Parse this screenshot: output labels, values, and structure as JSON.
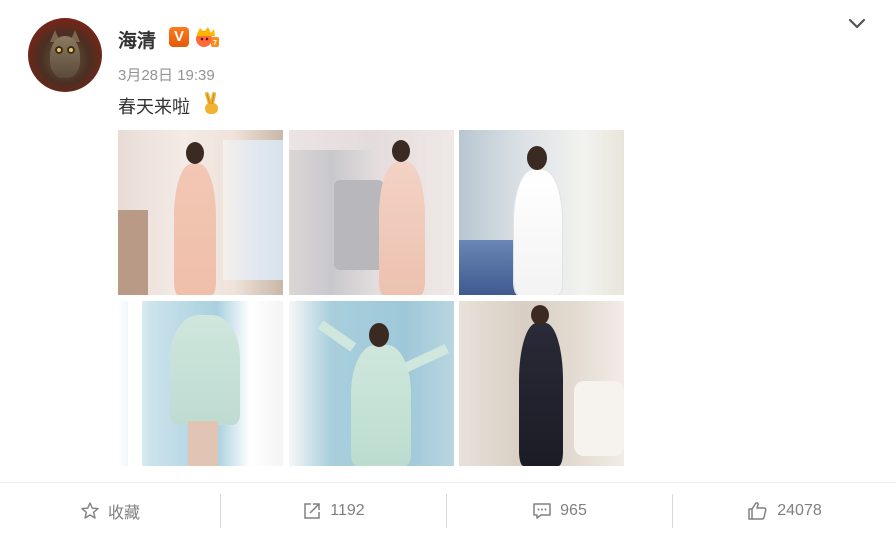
{
  "post": {
    "username": "海清",
    "verified_badge": "V",
    "timestamp": "3月28日 19:39",
    "text": "春天来啦",
    "emoji": "victory-hand",
    "photos": [
      {
        "name": "photo-1"
      },
      {
        "name": "photo-2"
      },
      {
        "name": "photo-3"
      },
      {
        "name": "photo-4"
      },
      {
        "name": "photo-5"
      },
      {
        "name": "photo-6"
      }
    ]
  },
  "actions": {
    "favorite_label": "收藏",
    "repost_count": "1192",
    "comment_count": "965",
    "like_count": "24078"
  },
  "icons": {
    "favorite": "star-icon",
    "repost": "share-icon",
    "comment": "comment-icon",
    "like": "thumbs-up-icon",
    "menu": "chevron-down-icon"
  },
  "colors": {
    "badge_orange": "#f06b11",
    "muted_text": "#808080",
    "timestamp_gray": "#939393"
  }
}
